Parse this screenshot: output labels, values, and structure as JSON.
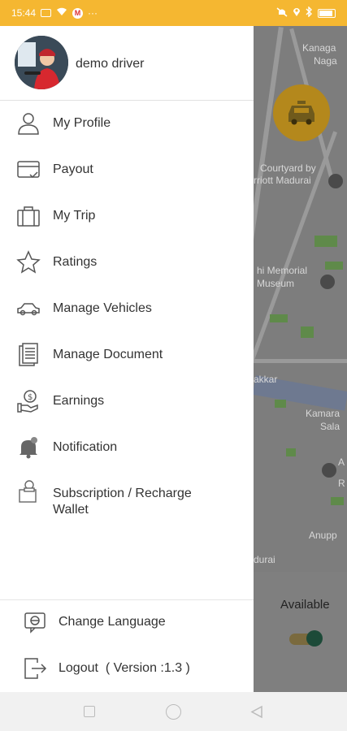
{
  "status_bar": {
    "time": "15:44",
    "icons": [
      "notification-icon",
      "wifi-icon",
      "gmail-icon",
      "more-dots-icon",
      "mute-icon",
      "location-icon",
      "bluetooth-icon",
      "battery-icon"
    ],
    "more": "···"
  },
  "drawer": {
    "driver_name": "demo driver",
    "menu": [
      {
        "label": "My Profile",
        "icon": "person-icon"
      },
      {
        "label": "Payout",
        "icon": "card-icon"
      },
      {
        "label": "My Trip",
        "icon": "briefcase-icon"
      },
      {
        "label": "Ratings",
        "icon": "star-icon"
      },
      {
        "label": "Manage Vehicles",
        "icon": "car-icon"
      },
      {
        "label": "Manage Document",
        "icon": "document-icon"
      },
      {
        "label": "Earnings",
        "icon": "money-hand-icon"
      },
      {
        "label": "Notification",
        "icon": "bell-icon"
      },
      {
        "label": "Subscription / Recharge\nWallet",
        "icon": "wallet-icon"
      }
    ],
    "footer": [
      {
        "label": "Change Language",
        "icon": "language-icon"
      },
      {
        "label": "Logout  ( Version :1.3 )",
        "icon": "logout-icon"
      }
    ]
  },
  "map": {
    "labels": [
      "Kanaga",
      "Naga",
      "Courtyard by",
      "rriott Madurai",
      "hi Memorial",
      "Museum",
      "akkar",
      "Kamara",
      "Sala",
      "A",
      "R",
      "Anupp",
      "durai"
    ]
  },
  "availability": {
    "label": "Available",
    "on": true
  },
  "colors": {
    "status_bar": "#F5B731",
    "accent": "#F5B731",
    "toggle_on": "#1c4a38"
  }
}
